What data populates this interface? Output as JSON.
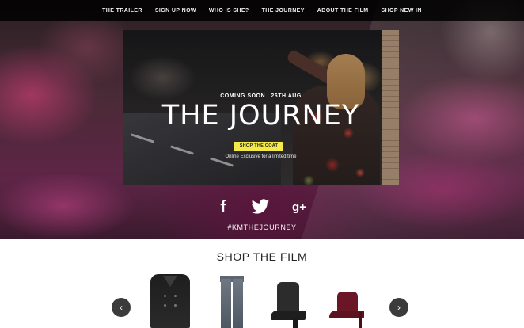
{
  "nav": {
    "items": [
      {
        "label": "THE TRAILER"
      },
      {
        "label": "SIGN UP NOW"
      },
      {
        "label": "WHO IS SHE?"
      },
      {
        "label": "THE JOURNEY"
      },
      {
        "label": "ABOUT THE FILM"
      },
      {
        "label": "SHOP NEW IN"
      }
    ]
  },
  "hero": {
    "kicker": "COMING SOON | 26TH AUG",
    "title": "THE JOURNEY",
    "cta": "SHOP THE COAT",
    "subtitle": "Online Exclusive for a limited time"
  },
  "social": {
    "facebook": "f",
    "googleplus": "g+",
    "hashtag": "#KMTHEJOURNEY"
  },
  "shop": {
    "title": "SHOP THE FILM",
    "prev_glyph": "‹",
    "next_glyph": "›"
  },
  "colors": {
    "cta_background": "#f4e84a",
    "nav_background": "#000000",
    "arrow_background": "#3b3b3b"
  },
  "icons": [
    "facebook-icon",
    "twitter-icon",
    "google-plus-icon",
    "chevron-left-icon",
    "chevron-right-icon"
  ]
}
